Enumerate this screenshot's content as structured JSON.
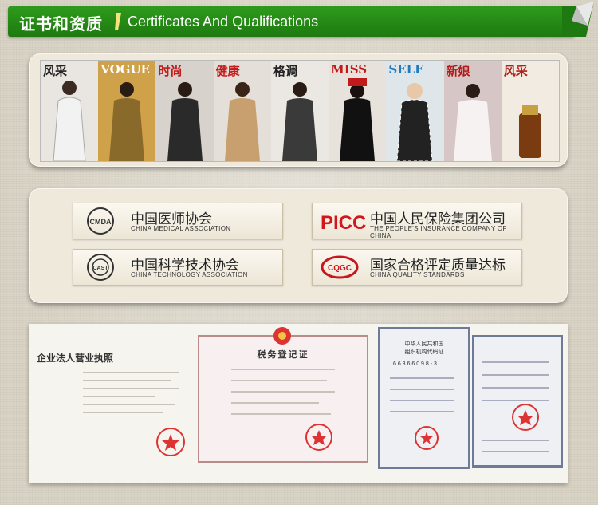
{
  "header": {
    "title_cn": "证书和资质",
    "title_en": "Certificates And Qualifications"
  },
  "magazines": [
    {
      "title": "风采",
      "color": "#222"
    },
    {
      "title": "VOGUE",
      "color": "#222"
    },
    {
      "title": "时尚",
      "color": "#c21a1a"
    },
    {
      "title": "健康",
      "color": "#c21a1a"
    },
    {
      "title": "格调",
      "color": "#222"
    },
    {
      "title": "MISS",
      "color": "#c21a1a"
    },
    {
      "title": "SELF",
      "color": "#1f7cc0"
    },
    {
      "title": "新娘",
      "color": "#b01b1b"
    },
    {
      "title": "风采",
      "color": "#b0201b"
    }
  ],
  "associations": [
    {
      "cn": "中国医师协会",
      "en": "CHINA MEDICAL ASSOCIATION",
      "logo": "CMDA"
    },
    {
      "cn": "中国人民保险集团公司",
      "en": "THE PEOPLE'S INSURANCE COMPANY OF CHINA",
      "logo": "PICC"
    },
    {
      "cn": "中国科学技术协会",
      "en": "CHINA TECHNOLOGY ASSOCIATION",
      "logo": "CAST"
    },
    {
      "cn": "国家合格评定质量达标",
      "en": "CHINA QUALITY STANDARDS",
      "logo": "CQGC"
    }
  ],
  "documents": {
    "business_license_title": "企业法人营业执照",
    "tax_title": "税务登记证",
    "org_title_line1": "中华人民共和国",
    "org_title_line2": "组织机构代码证",
    "org_number": "6 6 3 6 6 0 9 8 - 3"
  },
  "colors": {
    "ribbon_green": "#2e9a1c",
    "picc_red": "#d0181e",
    "cqgc_red": "#c8161d"
  }
}
